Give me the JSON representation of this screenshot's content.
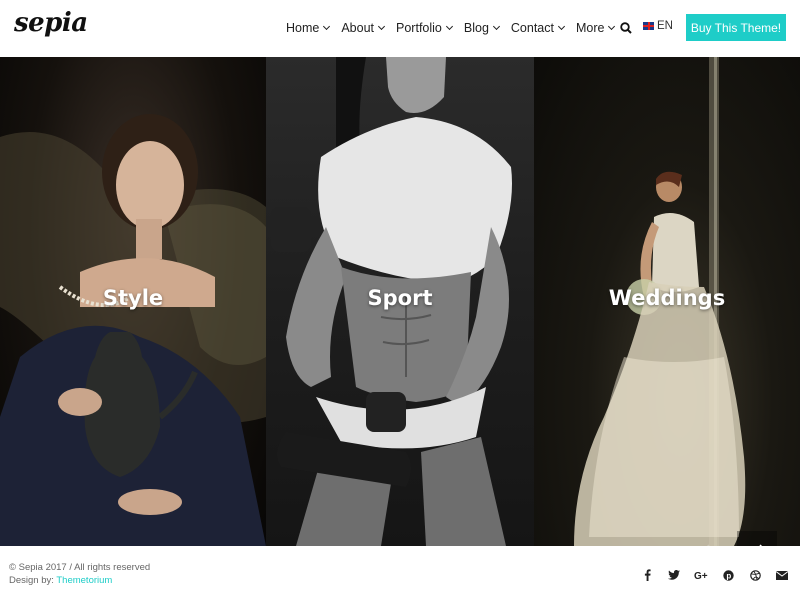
{
  "header": {
    "logo": "sepia",
    "nav": [
      {
        "label": "Home"
      },
      {
        "label": "About"
      },
      {
        "label": "Portfolio"
      },
      {
        "label": "Blog"
      },
      {
        "label": "Contact"
      },
      {
        "label": "More"
      }
    ],
    "search_icon": "search-icon",
    "language": "EN",
    "buy_button": "Buy This Theme!"
  },
  "panels": [
    {
      "title": "Style"
    },
    {
      "title": "Sport"
    },
    {
      "title": "Weddings"
    }
  ],
  "slider": {
    "prev_icon": "arrow-left-icon",
    "next_icon": "arrow-right-icon"
  },
  "footer": {
    "copyright": "© Sepia 2017  /  All rights reserved",
    "design_prefix": "Design by: ",
    "design_link": "Themetorium",
    "social": [
      "facebook-icon",
      "twitter-icon",
      "google-plus-icon",
      "pinterest-icon",
      "dribbble-icon",
      "email-icon"
    ]
  },
  "colors": {
    "accent": "#1ecdc8",
    "text": "#222222",
    "background": "#ffffff"
  }
}
